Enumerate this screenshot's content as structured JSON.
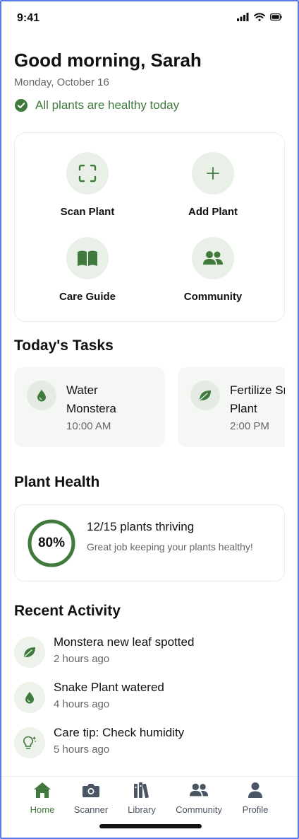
{
  "status_bar": {
    "time": "9:41"
  },
  "header": {
    "greeting": "Good morning, Sarah",
    "date": "Monday, October 16",
    "health_message": "All plants are healthy today"
  },
  "quick_actions": [
    {
      "label": "Scan Plant",
      "icon": "scan-icon"
    },
    {
      "label": "Add Plant",
      "icon": "plus-icon"
    },
    {
      "label": "Care Guide",
      "icon": "book-icon"
    },
    {
      "label": "Community",
      "icon": "people-icon"
    }
  ],
  "tasks": {
    "title": "Today's Tasks",
    "items": [
      {
        "title": "Water\nMonstera",
        "time": "10:00 AM",
        "icon": "water-drop-icon"
      },
      {
        "title": "Fertilize Snake\nPlant",
        "time": "2:00 PM",
        "icon": "leaf-icon"
      }
    ]
  },
  "plant_health": {
    "title": "Plant Health",
    "percent": 80,
    "percent_label": "80%",
    "summary": "12/15 plants thriving",
    "message": "Great job keeping your plants healthy!"
  },
  "recent_activity": {
    "title": "Recent Activity",
    "items": [
      {
        "title": "Monstera new leaf spotted",
        "time": "2 hours ago",
        "icon": "leaf-icon"
      },
      {
        "title": "Snake Plant watered",
        "time": "4 hours ago",
        "icon": "water-drop-icon"
      },
      {
        "title": "Care tip: Check humidity",
        "time": "5 hours ago",
        "icon": "lightbulb-icon"
      }
    ]
  },
  "tab_bar": [
    {
      "label": "Home",
      "icon": "home-icon",
      "active": true
    },
    {
      "label": "Scanner",
      "icon": "camera-icon",
      "active": false
    },
    {
      "label": "Library",
      "icon": "library-icon",
      "active": false
    },
    {
      "label": "Community",
      "icon": "people-icon",
      "active": false
    },
    {
      "label": "Profile",
      "icon": "profile-icon",
      "active": false
    }
  ],
  "colors": {
    "accent": "#3f7a3c",
    "accent_light": "#e9f0e7",
    "muted_text": "#666666",
    "tab_inactive": "#4a5563"
  }
}
